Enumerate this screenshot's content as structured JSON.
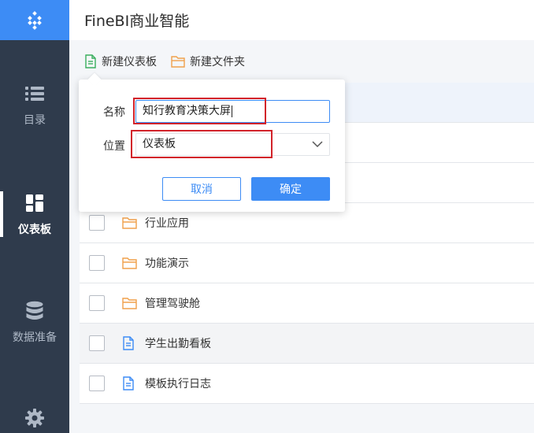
{
  "header": {
    "title": "FineBI商业智能"
  },
  "sidebar": {
    "items": [
      {
        "label": "目录",
        "icon": "list-icon",
        "active": false
      },
      {
        "label": "仪表板",
        "icon": "dashboard-grid-icon",
        "active": true
      },
      {
        "label": "数据准备",
        "icon": "database-icon",
        "active": false
      },
      {
        "label": "",
        "icon": "gear-icon",
        "active": false
      }
    ]
  },
  "toolbar": {
    "new_dashboard_label": "新建仪表板",
    "new_folder_label": "新建文件夹"
  },
  "dialog": {
    "name_label": "名称",
    "name_value": "知行教育决策大屏",
    "location_label": "位置",
    "location_value": "仪表板",
    "cancel_label": "取消",
    "ok_label": "确定"
  },
  "list": {
    "rows": [
      {
        "label": "",
        "type": "hidden"
      },
      {
        "label": "",
        "type": "hidden"
      },
      {
        "label": "",
        "type": "hidden"
      },
      {
        "label": "行业应用",
        "type": "folder"
      },
      {
        "label": "功能演示",
        "type": "folder"
      },
      {
        "label": "管理驾驶舱",
        "type": "folder"
      },
      {
        "label": "学生出勤看板",
        "type": "dashboard"
      },
      {
        "label": "模板执行日志",
        "type": "dashboard"
      }
    ]
  },
  "colors": {
    "sidebar_bg": "#2f3b4c",
    "accent": "#3d8cf5",
    "folder": "#f0a04b",
    "dashboard_file": "#3d8cf5",
    "highlight_box": "#d2232a"
  }
}
